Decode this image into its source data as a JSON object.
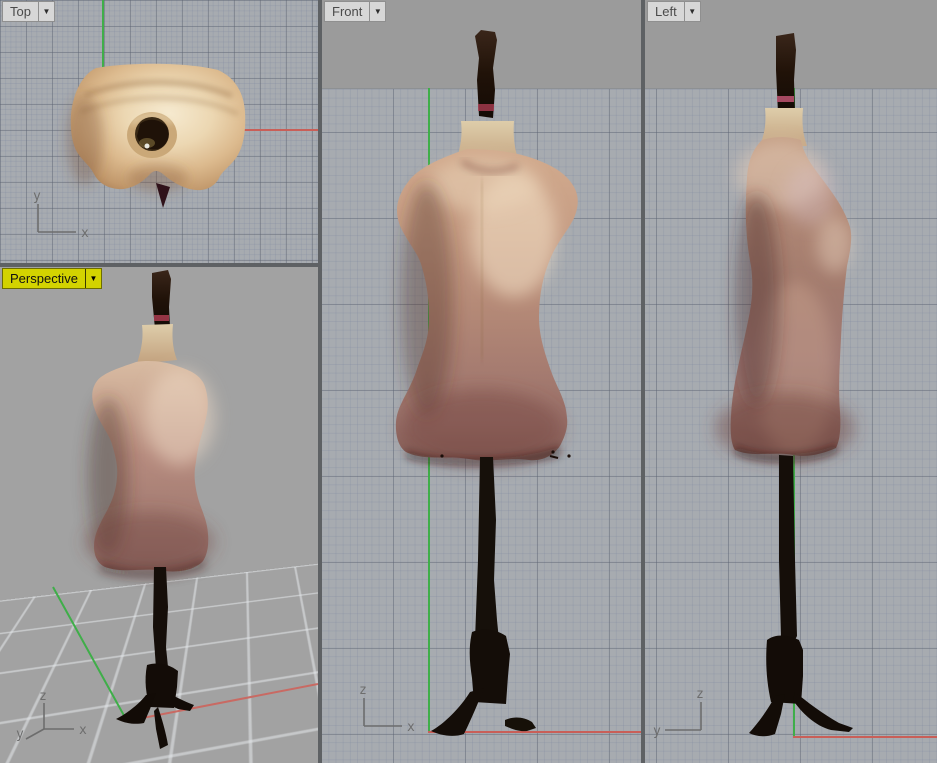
{
  "viewports": {
    "top": {
      "label": "Top",
      "active": false,
      "triad": {
        "v": "y",
        "h": "x"
      }
    },
    "front": {
      "label": "Front",
      "active": false,
      "triad": {
        "v": "z",
        "h": "x"
      }
    },
    "left": {
      "label": "Left",
      "active": false,
      "triad": {
        "v": "z",
        "h": "y"
      }
    },
    "perspective": {
      "label": "Perspective",
      "active": true,
      "triad": {
        "v": "z",
        "h": "x",
        "d": "y"
      }
    }
  },
  "icons": {
    "dropdown": "▼"
  },
  "colors": {
    "plain_bg": "#9b9b9b",
    "persp_bg": "#a2a2a2",
    "grid_bg": "#a7abb0",
    "grid_minor": "rgba(120,132,158,0.22)",
    "grid_major": "rgba(92,98,110,0.42)",
    "grid_ground_line": "rgba(228,231,234,0.55)",
    "divider": "#5e6164",
    "axis_green": "#3fae49",
    "axis_red": "#c95f58",
    "tab_bg": "#d7d7d7",
    "tab_border": "#8f8f8f",
    "tab_text": "#4a4a4a",
    "active_tab_bg": "#d3d300",
    "active_tab_text": "#111111",
    "triad_color": "#6d6d6d"
  }
}
